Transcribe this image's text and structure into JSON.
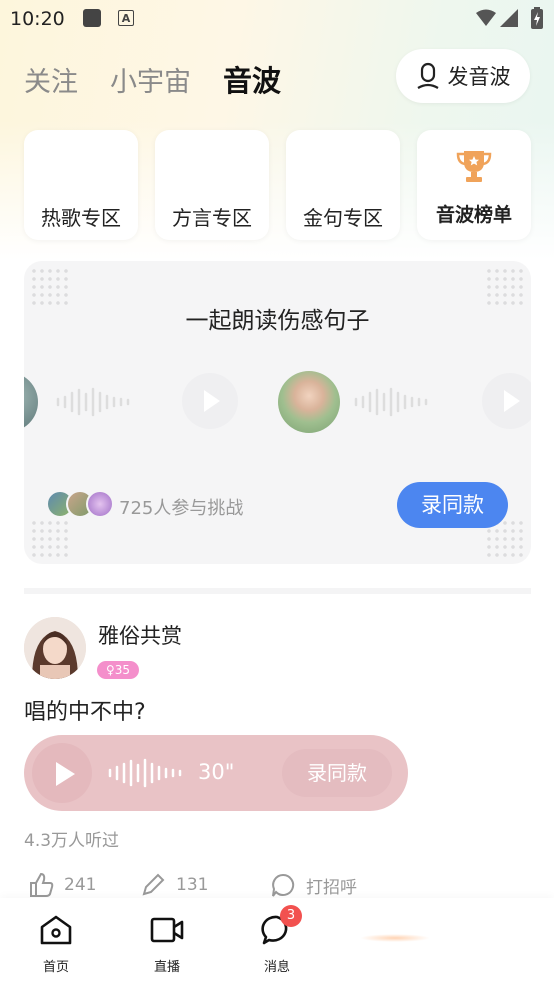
{
  "status_bar": {
    "time": "10:20"
  },
  "tabs": [
    {
      "label": "关注"
    },
    {
      "label": "小宇宙"
    },
    {
      "label": "音波"
    }
  ],
  "publish_button": {
    "label": "发音波"
  },
  "categories": [
    {
      "label": "热歌专区"
    },
    {
      "label": "方言专区"
    },
    {
      "label": "金句专区"
    },
    {
      "label": "音波榜单",
      "icon": "trophy-icon"
    }
  ],
  "challenge": {
    "title": "一起朗读伤感句子",
    "participants": "725人参与挑战",
    "record_button": "录同款"
  },
  "post": {
    "author": "雅俗共赏",
    "age_badge": "♀35",
    "text": "唱的中不中?",
    "audio_duration": "30\"",
    "record_button": "录同款",
    "listens": "4.3万人听过",
    "likes": "241",
    "comments": "131",
    "greet": "打招呼"
  },
  "bottom_nav": [
    {
      "label": "首页",
      "icon": "home-icon"
    },
    {
      "label": "直播",
      "icon": "video-icon"
    },
    {
      "label": "消息",
      "icon": "message-icon",
      "badge": "3"
    }
  ],
  "colors": {
    "accent_blue": "#4c86f0",
    "trophy_orange": "#f0a35a",
    "audio_pink": "#e9c3c6",
    "badge_red": "#f2514f",
    "age_badge_pink": "#f48fcb"
  }
}
